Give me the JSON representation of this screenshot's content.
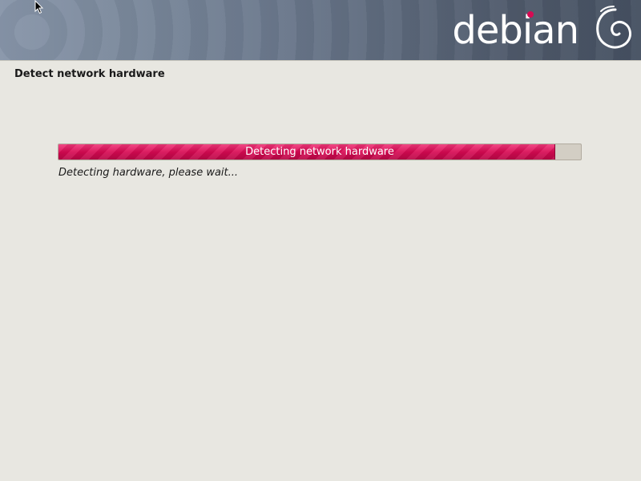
{
  "header": {
    "brand_text": "debian",
    "logo_icon": "debian-swirl-icon",
    "accent_color": "#d70a53"
  },
  "step": {
    "title": "Detect network hardware"
  },
  "progress": {
    "label": "Detecting network hardware",
    "percent": 95,
    "fill_color": "#d70a53",
    "status": "Detecting hardware, please wait..."
  },
  "cursor_icon": "mouse-pointer-icon"
}
